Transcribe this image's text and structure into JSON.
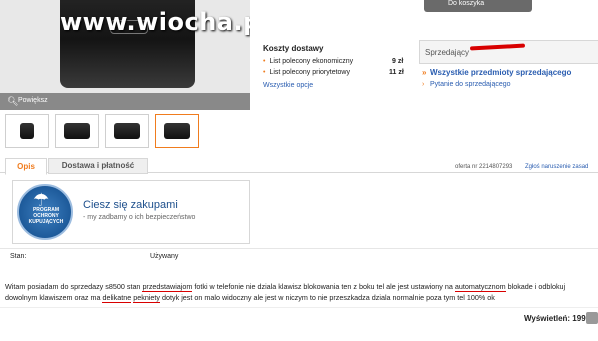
{
  "gallery": {
    "watermark": "www.wiocha.pl",
    "zoom_label": "Powiększ"
  },
  "cart": {
    "button_label": "Do koszyka"
  },
  "shipping": {
    "title": "Koszty dostawy",
    "rows": [
      {
        "label": "List polecony ekonomiczny",
        "price": "9 zł"
      },
      {
        "label": "List polecony priorytetowy",
        "price": "11 zł"
      }
    ],
    "link": "Wszystkie opcje"
  },
  "seller": {
    "label": "Sprzedający",
    "link_items": "Wszystkie przedmioty sprzedającego",
    "link_question": "Pytanie do sprzedającego"
  },
  "tabs": [
    {
      "label": "Opis"
    },
    {
      "label": "Dostawa i płatność"
    }
  ],
  "offer": {
    "number": "oferta nr 2214807293",
    "report": "Zgłoś naruszenie zasad"
  },
  "safety": {
    "seal_text": "PROGRAM OCHRONY KUPUJĄCYCH",
    "title": "Ciesz się zakupami",
    "subtitle": "- my zadbamy o ich bezpieczeństwo"
  },
  "state": {
    "label": "Stan:",
    "value": "Używany"
  },
  "description": {
    "p1": "Witam posiadam do sprzedazy s8500 stan ",
    "u1": "przedstawiajom",
    "p2": " fotki w telefonie nie dziala klawisz blokowania ten z boku tel ale jest ustawiony na ",
    "u2": "automatycznom",
    "p3": " blokade i odblokuj dowolnym klawiszem oraz ma ",
    "u3": "delikatne",
    "p4": " ",
    "u4": "pekniety",
    "p5": " dotyk jest on malo widoczny ale jest w niczym to nie przeszkadza dziala normalnie poza tym tel 100% ok"
  },
  "views": {
    "label": "Wyświetleń: 199"
  },
  "colors": {
    "accent": "#f07c1e",
    "link": "#2a5db0",
    "redact": "#d80000",
    "seal": "#1d5a9a"
  }
}
